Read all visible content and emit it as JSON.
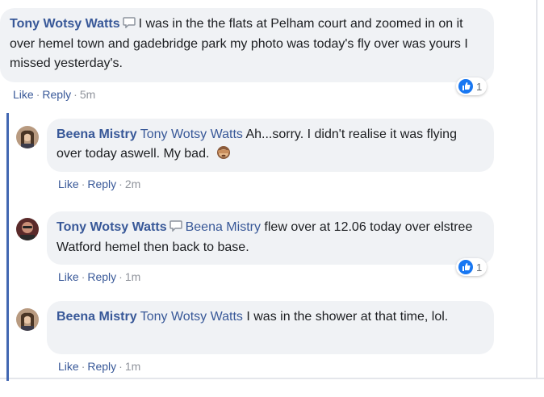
{
  "comments": [
    {
      "author": "Tony Wotsy Watts",
      "text": "I was in the the flats at Pelham court and zoomed in on it over hemel town and gadebridge park my photo was today's fly over was yours I missed yesterday's.",
      "like": "Like",
      "reply": "Reply",
      "time": "5m",
      "reactions": "1"
    },
    {
      "author": "Beena Mistry",
      "mention": "Tony Wotsy Watts",
      "text": "Ah...sorry. I didn't realise it was flying over today aswell. My bad.",
      "like": "Like",
      "reply": "Reply",
      "time": "2m"
    },
    {
      "author": "Tony Wotsy Watts",
      "mention": "Beena Mistry",
      "text": "flew over at 12.06 today over elstree Watford hemel then back to base.",
      "like": "Like",
      "reply": "Reply",
      "time": "1m",
      "reactions": "1"
    },
    {
      "author": "Beena Mistry",
      "mention": "Tony Wotsy Watts",
      "text": "I was in the shower at that time, lol.",
      "like": "Like",
      "reply": "Reply",
      "time": "1m"
    }
  ],
  "separator": "·",
  "icons": {
    "conversation": "chat-bubble-icon",
    "reaction": "thumbs-up-icon",
    "emoji": "see-no-evil-monkey-emoji"
  },
  "colors": {
    "name": "#385898",
    "bubble": "#f0f2f5",
    "thread": "#4267b2",
    "like_reaction": "#1877f2"
  }
}
